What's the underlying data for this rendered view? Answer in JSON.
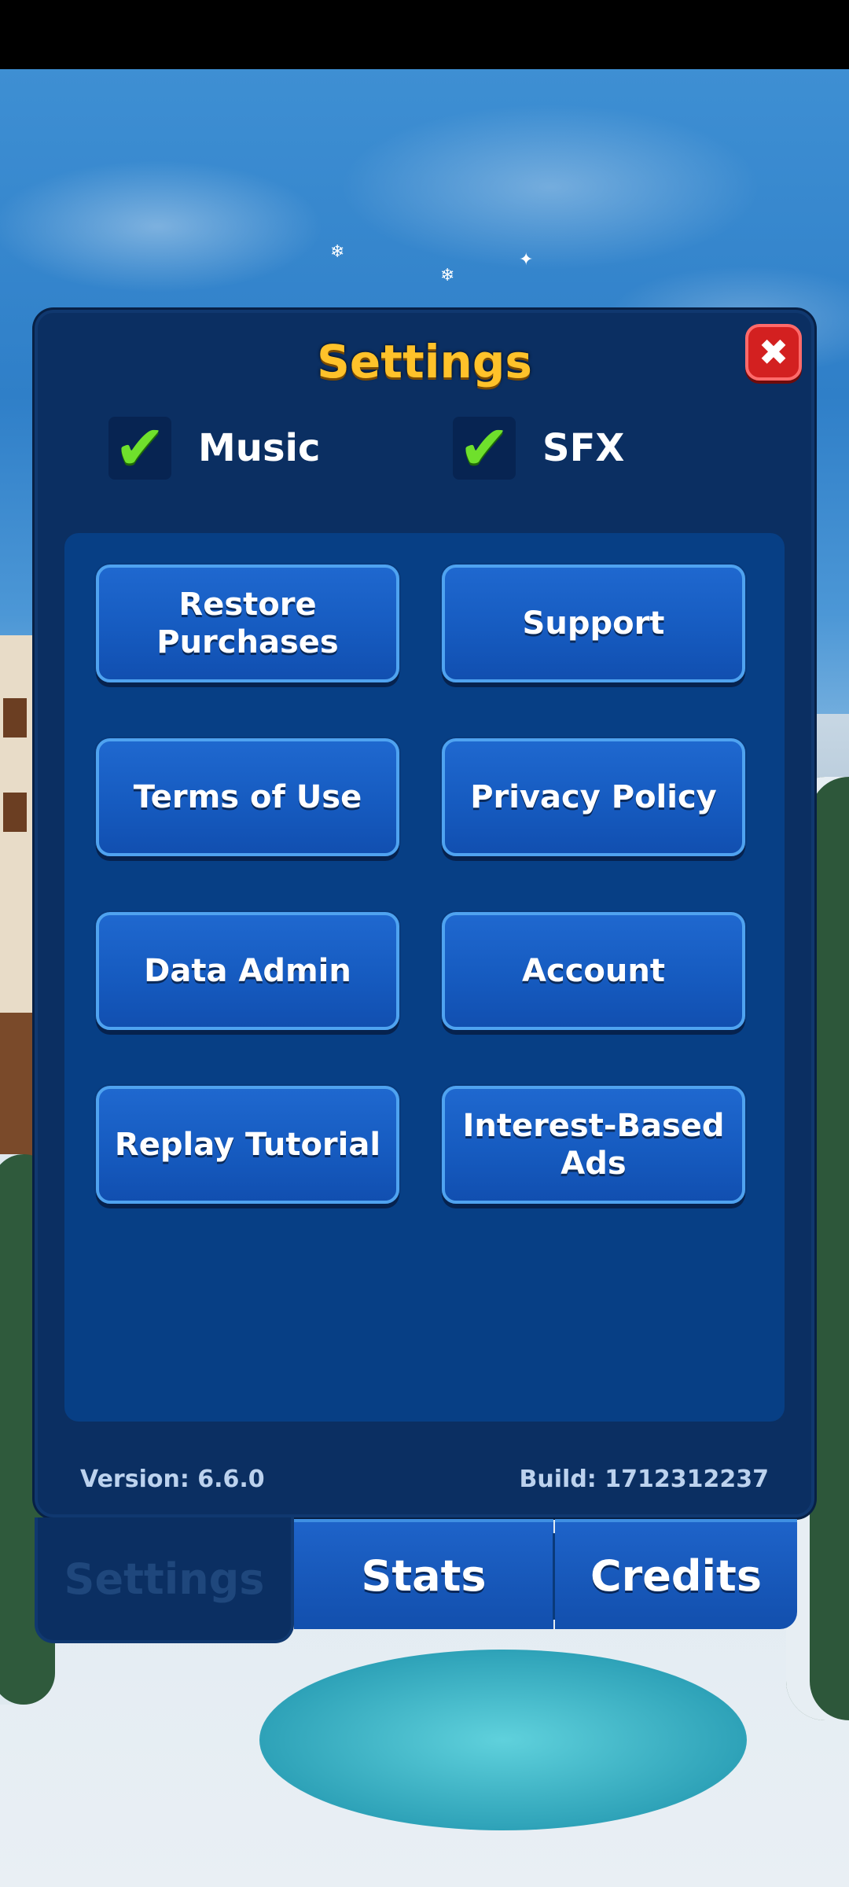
{
  "dialog": {
    "title": "Settings",
    "close_icon": "close-icon"
  },
  "toggles": [
    {
      "label": "Music",
      "checked": true
    },
    {
      "label": "SFX",
      "checked": true
    }
  ],
  "buttons": [
    {
      "label": "Restore\nPurchases"
    },
    {
      "label": "Support"
    },
    {
      "label": "Terms of Use"
    },
    {
      "label": "Privacy Policy"
    },
    {
      "label": "Data Admin"
    },
    {
      "label": "Account"
    },
    {
      "label": "Replay Tutorial"
    },
    {
      "label": "Interest-Based\nAds"
    }
  ],
  "footer": {
    "version": "Version: 6.6.0",
    "build": "Build: 1712312237"
  },
  "tabs": [
    {
      "label": "Settings",
      "active": true
    },
    {
      "label": "Stats",
      "active": false
    },
    {
      "label": "Credits",
      "active": false
    }
  ],
  "colors": {
    "title": "#ffc22a",
    "panel": "#0b2f62",
    "button": "#165bc0",
    "close": "#d32020",
    "check": "#6fe02c"
  }
}
